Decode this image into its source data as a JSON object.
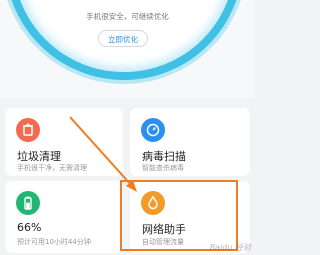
{
  "score": {
    "status_text": "手机很安全，可继续优化",
    "optimize_button": "立即优化"
  },
  "cards": {
    "junk_clean": {
      "title": "垃圾清理",
      "subtitle": "手机很干净，无需清理",
      "icon": "trash-icon",
      "color": "#f26b50"
    },
    "virus_scan": {
      "title": "病毒扫描",
      "subtitle": "智能查杀病毒",
      "icon": "clock-scan-icon",
      "color": "#2d8ff0"
    },
    "battery": {
      "title": "66%",
      "subtitle": "预计可用10小时44分钟",
      "icon": "battery-icon",
      "color": "#22b573",
      "level": 0.66
    },
    "network": {
      "title": "网络助手",
      "subtitle": "自动管理流量",
      "icon": "drop-icon",
      "color": "#f39a2b"
    }
  },
  "annotation": {
    "highlight_color": "#f07d22"
  },
  "watermark": "Baidu 经验"
}
